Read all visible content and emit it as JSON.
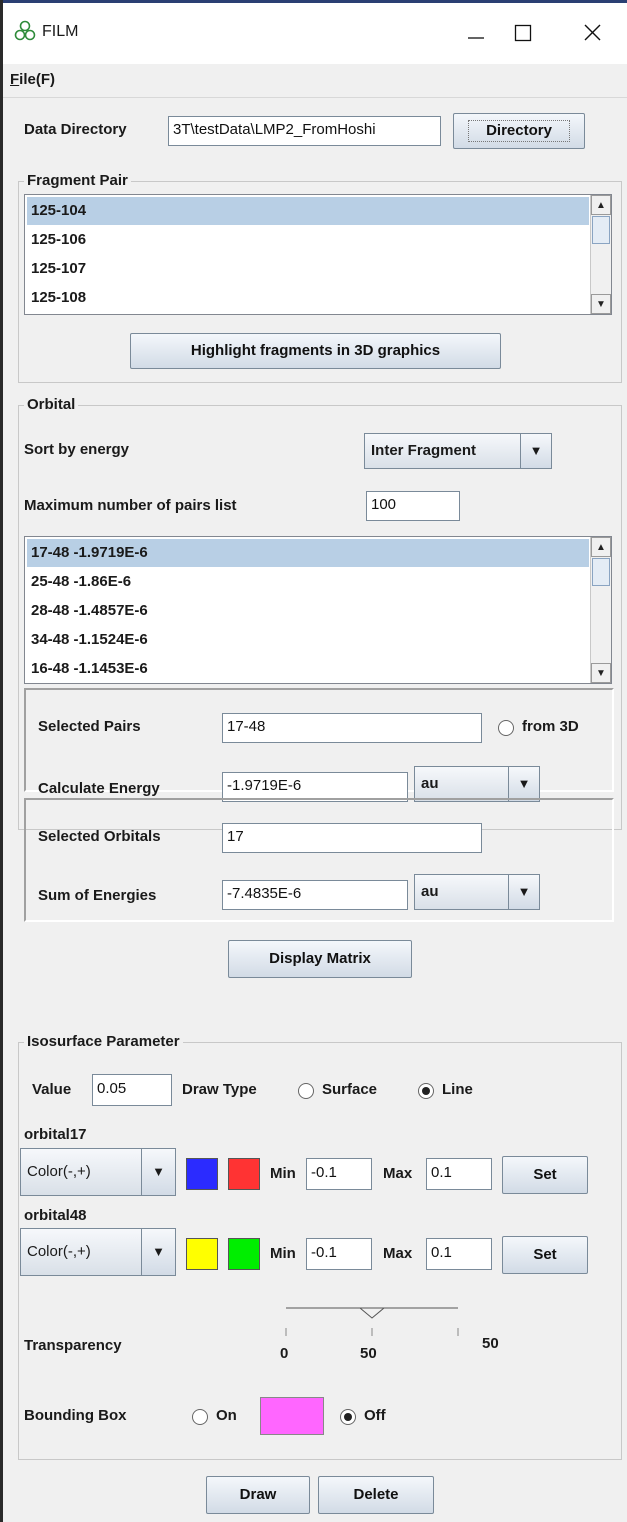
{
  "window": {
    "title": "FILM",
    "app_icon": "film-logo-icon",
    "minimize_icon": "minimize-icon",
    "maximize_icon": "maximize-icon",
    "close_icon": "close-icon"
  },
  "menu": {
    "file_label": "File(F)",
    "file_mnemonic": "F",
    "file_rest": "ile(F)"
  },
  "data_directory": {
    "label": "Data Directory",
    "value": "3T\\testData\\LMP2_FromHoshi",
    "button": "Directory"
  },
  "fragment_pair": {
    "legend": "Fragment Pair",
    "items": [
      "125-104",
      "125-106",
      "125-107",
      "125-108"
    ],
    "selected_index": 0,
    "highlight_button": "Highlight fragments in 3D graphics"
  },
  "orbital": {
    "legend": "Orbital",
    "sort_label": "Sort by energy",
    "sort_value": "Inter Fragment",
    "max_pairs_label": "Maximum number of pairs list",
    "max_pairs_value": "100",
    "items": [
      "17-48 -1.9719E-6",
      "25-48 -1.86E-6",
      "28-48 -1.4857E-6",
      "34-48 -1.1524E-6",
      "16-48 -1.1453E-6"
    ],
    "selected_index": 0,
    "selected_pairs_label": "Selected Pairs",
    "selected_pairs_value": "17-48",
    "from3d_label": "from 3D",
    "from3d_checked": false,
    "calc_energy_label": "Calculate Energy",
    "calc_energy_value": "-1.9719E-6",
    "calc_energy_unit": "au",
    "selected_orbitals_label": "Selected Orbitals",
    "selected_orbitals_value": "17",
    "sum_energies_label": "Sum of Energies",
    "sum_energies_value": "-7.4835E-6",
    "sum_energies_unit": "au",
    "display_matrix_button": "Display Matrix"
  },
  "isosurface": {
    "legend": "Isosurface Parameter",
    "value_label": "Value",
    "value": "0.05",
    "draw_type_label": "Draw Type",
    "surface_label": "Surface",
    "line_label": "Line",
    "draw_type_selected": "Line",
    "orbitals": [
      {
        "name": "orbital17",
        "color_mode": "Color(-,+)",
        "neg_color": "#2b2bff",
        "pos_color": "#ff3333",
        "min_label": "Min",
        "min": "-0.1",
        "max_label": "Max",
        "max": "0.1",
        "set_button": "Set"
      },
      {
        "name": "orbital48",
        "color_mode": "Color(-,+)",
        "neg_color": "#ffff00",
        "pos_color": "#00ee00",
        "min_label": "Min",
        "min": "-0.1",
        "max_label": "Max",
        "max": "0.1",
        "set_button": "Set"
      }
    ],
    "transparency_label": "Transparency",
    "transparency_value": 50,
    "transparency_tick_min": "0",
    "transparency_tick_mid": "50",
    "transparency_readout": "50",
    "bounding_box_label": "Bounding Box",
    "bb_on_label": "On",
    "bb_off_label": "Off",
    "bb_selected": "Off",
    "bb_color": "#ff66ff"
  },
  "footer": {
    "draw_button": "Draw",
    "delete_button": "Delete"
  }
}
